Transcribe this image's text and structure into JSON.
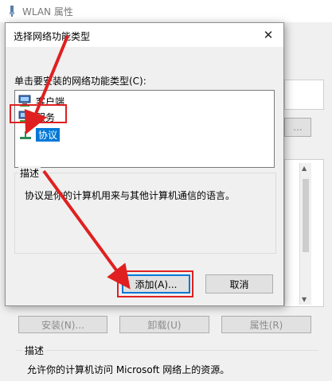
{
  "background_window": {
    "title": "WLAN 属性",
    "buttons": {
      "install": "安装(N)...",
      "uninstall": "卸载(U)",
      "properties": "属性(R)"
    },
    "description_label": "描述",
    "description_text": "允许你的计算机访问 Microsoft 网络上的资源。",
    "more_button": "..."
  },
  "dialog": {
    "title": "选择网络功能类型",
    "close_glyph": "✕",
    "prompt": "单击要安装的网络功能类型(C):",
    "items": [
      {
        "label": "客户端",
        "icon": "client-icon"
      },
      {
        "label": "服务",
        "icon": "service-icon"
      },
      {
        "label": "协议",
        "icon": "protocol-icon",
        "selected": true
      }
    ],
    "description_label": "描述",
    "description_text": "协议是你的计算机用来与其他计算机通信的语言。",
    "add_button": "添加(A)...",
    "cancel_button": "取消"
  },
  "colors": {
    "accent": "#0078d7",
    "annotation": "#e02020"
  }
}
